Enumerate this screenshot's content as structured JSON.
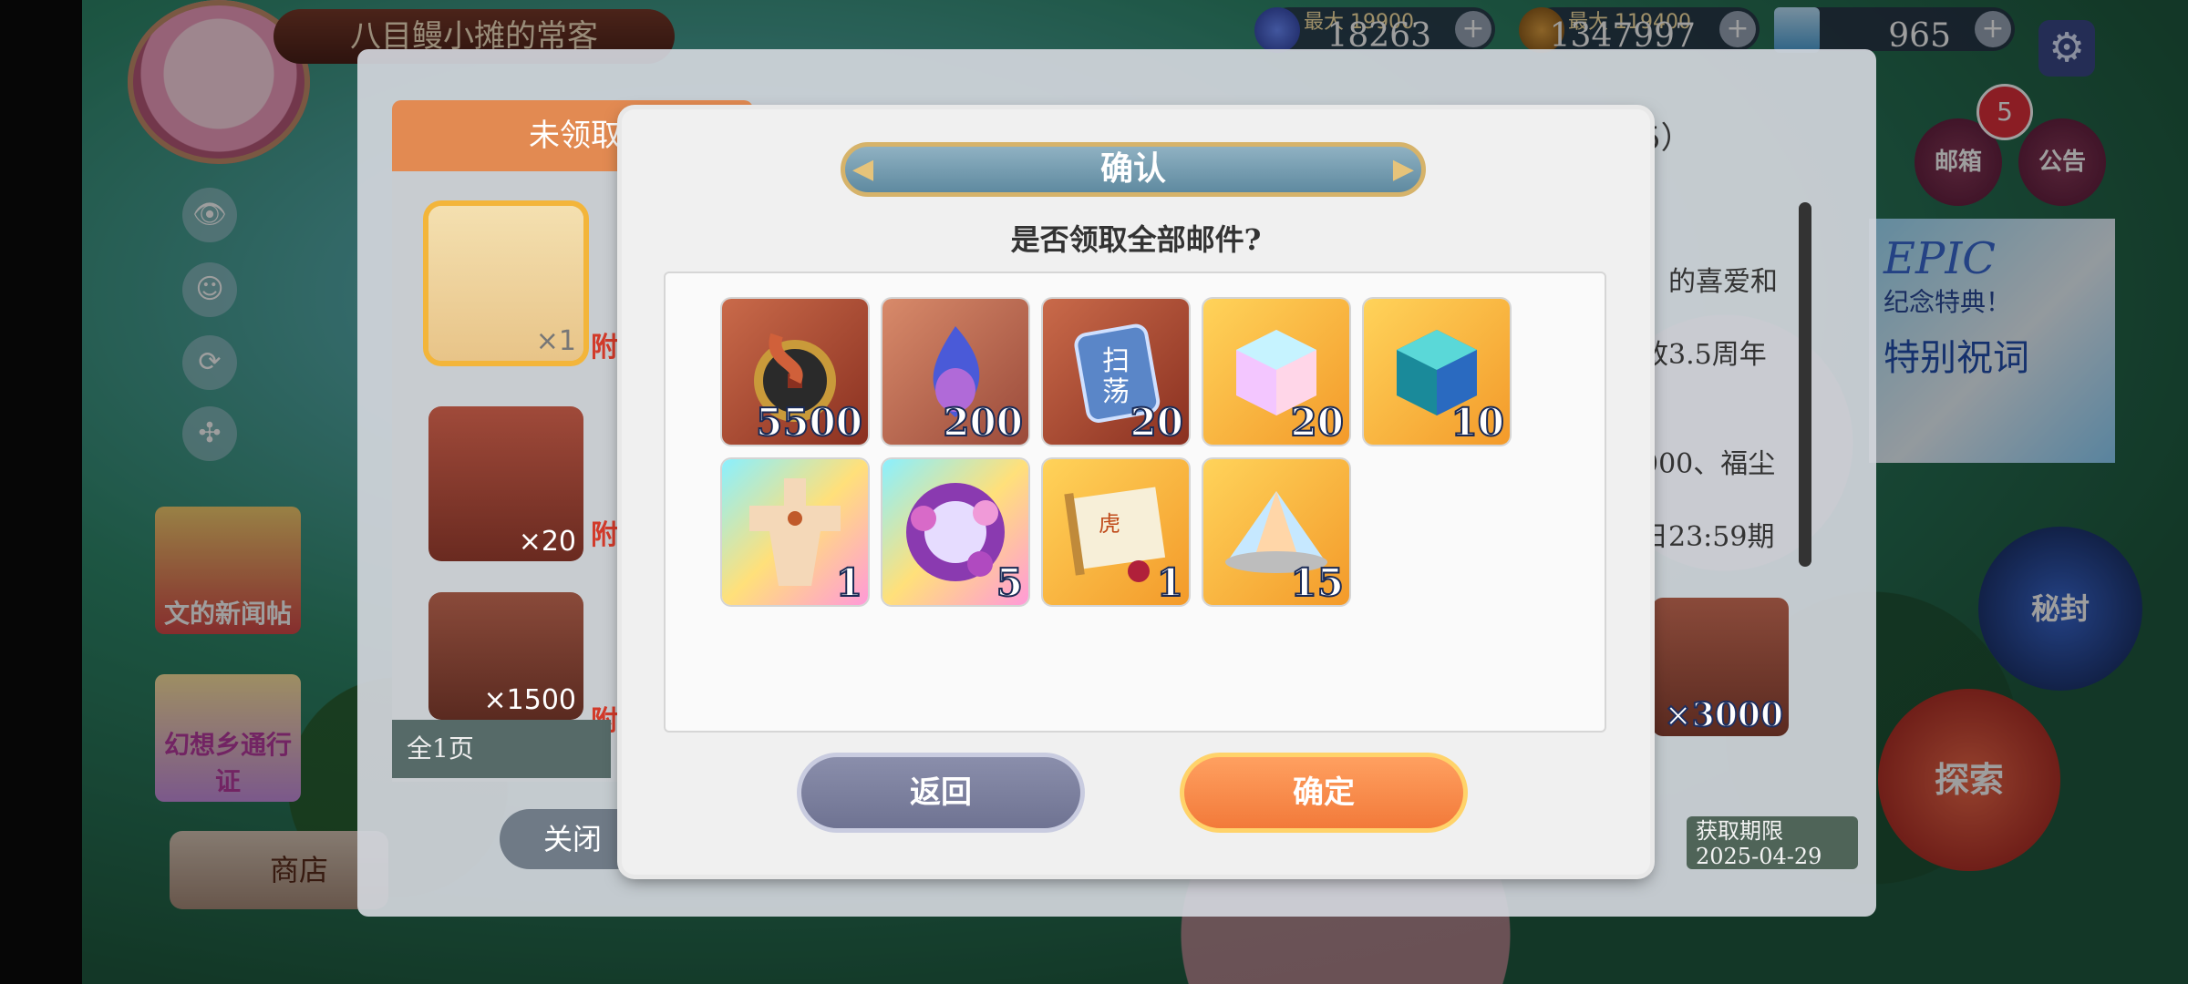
{
  "hud": {
    "player_title": "八目鳗小摊的常客",
    "res1": {
      "cap": "最大 19900",
      "val": "18263"
    },
    "res2": {
      "cap": "最大 119400",
      "val": "1347997"
    },
    "res3": {
      "val": "965"
    },
    "plus": "+"
  },
  "mail_window": {
    "tab_label": "未领取",
    "header_tail": "5）",
    "pager": "全1页",
    "close_label": "关闭",
    "detail_lines": [
      "》的喜爱和",
      "致3.5周年",
      "000、福尘",
      "日23:59期"
    ],
    "list_qty": [
      "×1",
      "×20",
      "×1500"
    ],
    "list_tags": [
      "附",
      "附",
      "附"
    ],
    "right_item_qty": "×3000",
    "expire_label": "获取期限",
    "expire_date": "2025-04-29"
  },
  "right_panel": {
    "mail_label": "邮箱",
    "notice_label": "公告",
    "badge_count": "5",
    "banner_epic": "EPIC",
    "banner_line1": "纪念特典！",
    "banner_line2": "特别祝词",
    "seal_label": "秘封",
    "explore_label": "探索"
  },
  "left_panel": {
    "card1": "文的新闻帖",
    "card2": "幻想乡通行证",
    "shop_label": "商店"
  },
  "modal": {
    "title": "确认",
    "question": "是否领取全部邮件?",
    "items": [
      {
        "icon": "coin-string-icon",
        "qty": "5500"
      },
      {
        "icon": "blue-flame-icon",
        "qty": "200"
      },
      {
        "icon": "sweep-ticket-icon",
        "qty": "20"
      },
      {
        "icon": "rainbow-cube-icon",
        "qty": "20"
      },
      {
        "icon": "crystal-cube-icon",
        "qty": "10"
      },
      {
        "icon": "paper-doll-icon",
        "qty": "1"
      },
      {
        "icon": "flower-orb-icon",
        "qty": "5"
      },
      {
        "icon": "scroll-icon",
        "qty": "1"
      },
      {
        "icon": "crystal-dust-icon",
        "qty": "15"
      }
    ],
    "back_label": "返回",
    "confirm_label": "确定"
  }
}
